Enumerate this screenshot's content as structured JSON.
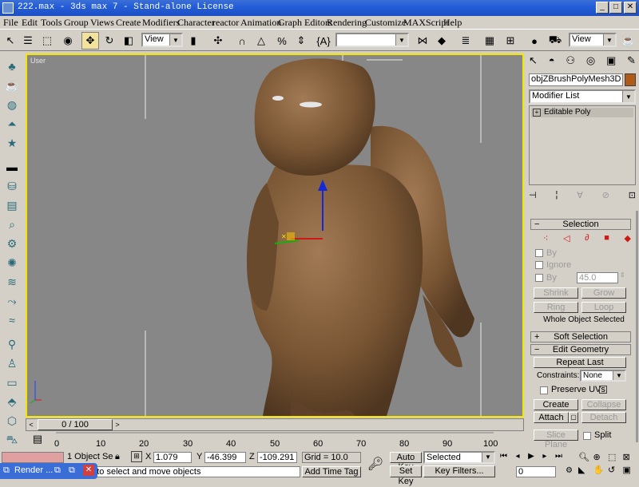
{
  "window": {
    "title": "222.max - 3ds max 7 - Stand-alone License",
    "controls": {
      "minimize": "_",
      "maximize": "□",
      "close": "✕"
    }
  },
  "menu": [
    "File",
    "Edit",
    "Tools",
    "Group",
    "Views",
    "Create",
    "Modifiers",
    "Character",
    "reactor",
    "Animation",
    "Graph Editors",
    "Rendering",
    "Customize",
    "MAXScript",
    "Help"
  ],
  "toolbar": {
    "selection_filter": "View",
    "named_selection": "",
    "view_dropdown": "View"
  },
  "viewport": {
    "label": "User"
  },
  "command_panel": {
    "object_name": "objZBrushPolyMesh3D",
    "object_color": "#b05a1a",
    "modifier_list": "Modifier List",
    "stack_item": "Editable Poly",
    "selection": {
      "title": "Selection",
      "by_vertex": "By Vertex",
      "by": "By",
      "ignore": "Ignore",
      "by_angle": "By",
      "angle_value": "45.0",
      "shrink": "Shrink",
      "grow": "Grow",
      "ring": "Ring",
      "loop": "Loop",
      "status": "Whole Object Selected"
    },
    "soft_selection": "Soft Selection",
    "edit_geometry": {
      "title": "Edit Geometry",
      "repeat_last": "Repeat Last",
      "constraints_label": "Constraints:",
      "constraints_value": "None",
      "preserve_uvs": "Preserve UVs",
      "create": "Create",
      "collapse": "Collapse",
      "attach": "Attach",
      "detach": "Detach",
      "slice_plane": "Slice Plane",
      "split": "Split"
    }
  },
  "timeline": {
    "frame_display": "0 / 100",
    "ticks": [
      "0",
      "10",
      "20",
      "30",
      "40",
      "50",
      "60",
      "70",
      "80",
      "90",
      "100"
    ]
  },
  "status": {
    "selection_info": "1 Object Se",
    "x_label": "X",
    "x_value": "1.079",
    "y_label": "Y",
    "y_value": "-46.399",
    "z_label": "Z",
    "z_value": "-109.291",
    "grid": "Grid = 10.0",
    "prompt": "d drag to select and move objects",
    "add_time_tag": "Add Time Tag",
    "auto_key": "Auto Key",
    "key_mode": "Selected",
    "set_key": "Set Key",
    "key_filters": "Key Filters...",
    "current_frame": "0",
    "taskbar_item": "Render ..."
  }
}
